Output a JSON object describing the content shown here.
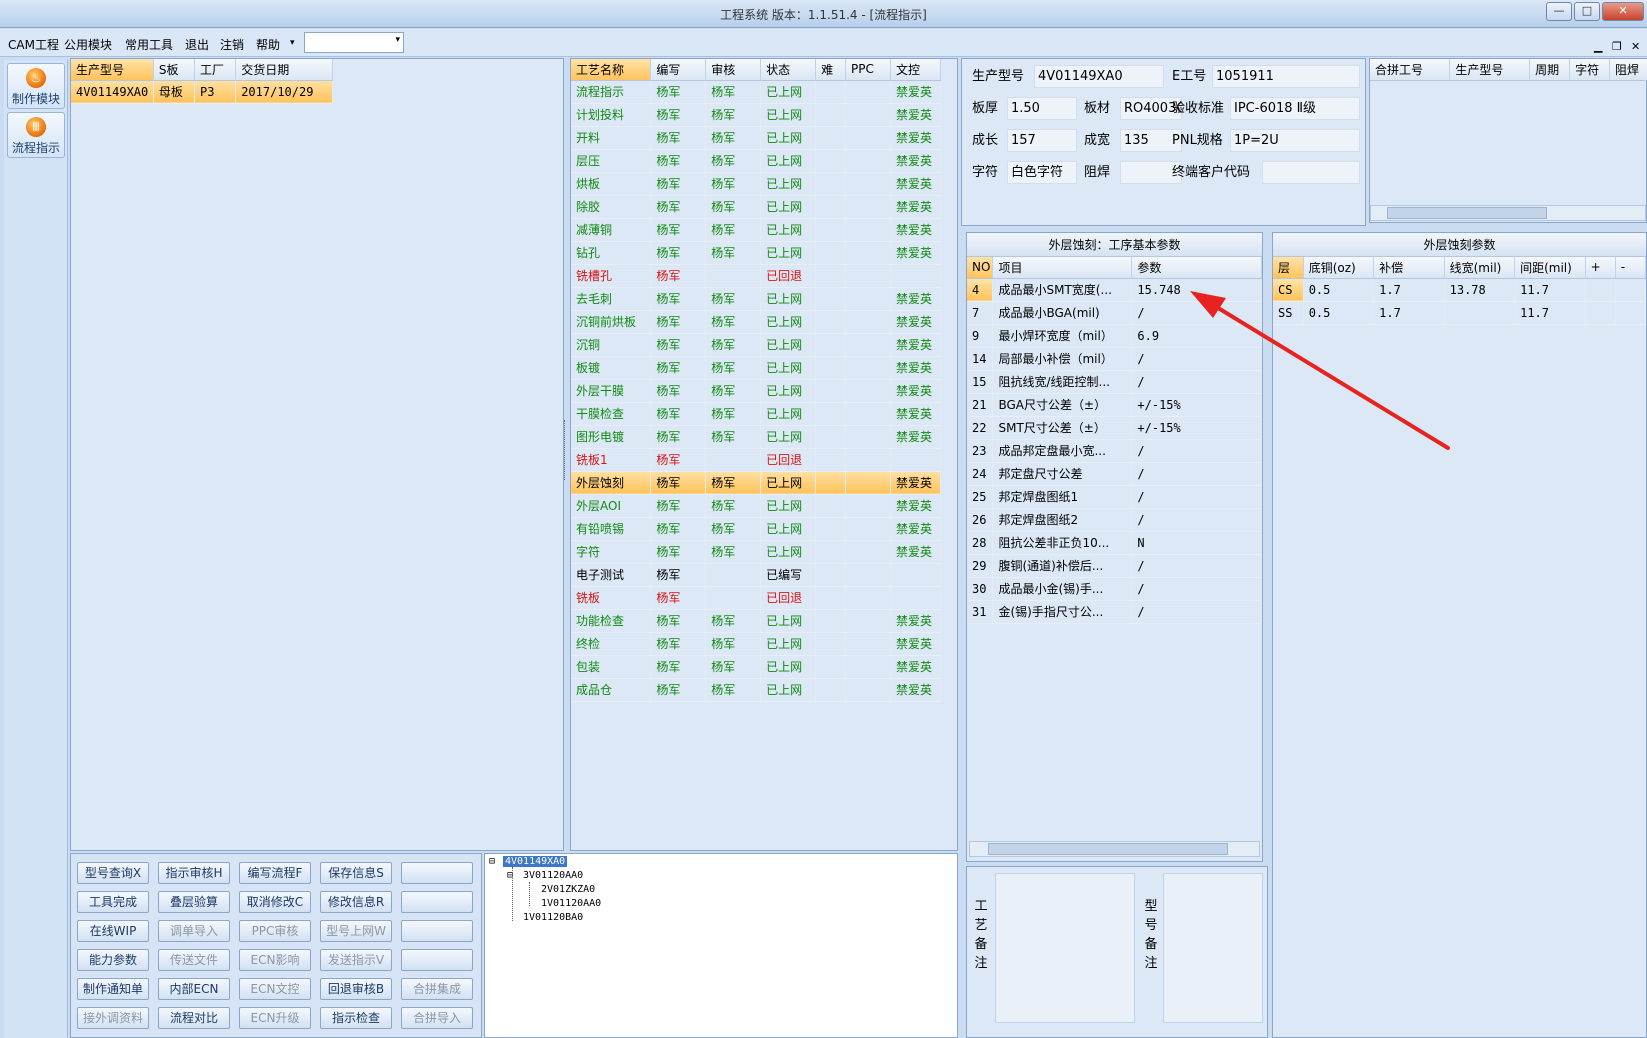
{
  "window": {
    "title": "工程系统   版本：1.1.51.4 - [流程指示]",
    "minimize": "—",
    "restore": "□",
    "close": "✕"
  },
  "menu": {
    "items": [
      "CAM工程",
      "公用模块",
      "常用工具",
      "退出",
      "注销",
      "帮助"
    ],
    "dropdown_arrow": "▾",
    "combo_value": "",
    "combo_arrow": "▾",
    "mdi_min": "▁",
    "mdi_restore": "❐",
    "mdi_close": "✕"
  },
  "left_nav": [
    {
      "label": "制作模块",
      "icon": "flame-icon",
      "glyph": "♨"
    },
    {
      "label": "流程指示",
      "icon": "flame-icon",
      "glyph": "Ⅲ"
    }
  ],
  "job_list": {
    "headers": [
      "生产型号",
      "S板",
      "工厂",
      "交货日期"
    ],
    "rows": [
      [
        "4V01149XA0",
        "母板",
        "P3",
        "2017/10/29"
      ]
    ]
  },
  "process": {
    "headers": [
      "工艺名称",
      "编写",
      "审核",
      "状态",
      "难",
      "PPC",
      "文控"
    ],
    "rows": [
      {
        "name": "流程指示",
        "writer": "杨军",
        "reviewer": "杨军",
        "status": "已上网",
        "control": "禁爱英",
        "color": "green"
      },
      {
        "name": "计划投料",
        "writer": "杨军",
        "reviewer": "杨军",
        "status": "已上网",
        "control": "禁爱英",
        "color": "green"
      },
      {
        "name": "开料",
        "writer": "杨军",
        "reviewer": "杨军",
        "status": "已上网",
        "control": "禁爱英",
        "color": "green"
      },
      {
        "name": "层压",
        "writer": "杨军",
        "reviewer": "杨军",
        "status": "已上网",
        "control": "禁爱英",
        "color": "green"
      },
      {
        "name": "烘板",
        "writer": "杨军",
        "reviewer": "杨军",
        "status": "已上网",
        "control": "禁爱英",
        "color": "green"
      },
      {
        "name": "除胶",
        "writer": "杨军",
        "reviewer": "杨军",
        "status": "已上网",
        "control": "禁爱英",
        "color": "green"
      },
      {
        "name": "减薄铜",
        "writer": "杨军",
        "reviewer": "杨军",
        "status": "已上网",
        "control": "禁爱英",
        "color": "green"
      },
      {
        "name": "钻孔",
        "writer": "杨军",
        "reviewer": "杨军",
        "status": "已上网",
        "control": "禁爱英",
        "color": "green"
      },
      {
        "name": "铣槽孔",
        "writer": "杨军",
        "reviewer": "",
        "status": "已回退",
        "control": "",
        "color": "red"
      },
      {
        "name": "去毛刺",
        "writer": "杨军",
        "reviewer": "杨军",
        "status": "已上网",
        "control": "禁爱英",
        "color": "green"
      },
      {
        "name": "沉铜前烘板",
        "writer": "杨军",
        "reviewer": "杨军",
        "status": "已上网",
        "control": "禁爱英",
        "color": "green"
      },
      {
        "name": "沉铜",
        "writer": "杨军",
        "reviewer": "杨军",
        "status": "已上网",
        "control": "禁爱英",
        "color": "green"
      },
      {
        "name": "板镀",
        "writer": "杨军",
        "reviewer": "杨军",
        "status": "已上网",
        "control": "禁爱英",
        "color": "green"
      },
      {
        "name": "外层干膜",
        "writer": "杨军",
        "reviewer": "杨军",
        "status": "已上网",
        "control": "禁爱英",
        "color": "green"
      },
      {
        "name": "干膜检查",
        "writer": "杨军",
        "reviewer": "杨军",
        "status": "已上网",
        "control": "禁爱英",
        "color": "green"
      },
      {
        "name": "图形电镀",
        "writer": "杨军",
        "reviewer": "杨军",
        "status": "已上网",
        "control": "禁爱英",
        "color": "green"
      },
      {
        "name": "铣板1",
        "writer": "杨军",
        "reviewer": "",
        "status": "已回退",
        "control": "",
        "color": "red"
      },
      {
        "name": "外层蚀刻",
        "writer": "杨军",
        "reviewer": "杨军",
        "status": "已上网",
        "control": "禁爱英",
        "color": "selected"
      },
      {
        "name": "外层AOI",
        "writer": "杨军",
        "reviewer": "杨军",
        "status": "已上网",
        "control": "禁爱英",
        "color": "green"
      },
      {
        "name": "有铅喷锡",
        "writer": "杨军",
        "reviewer": "杨军",
        "status": "已上网",
        "control": "禁爱英",
        "color": "green"
      },
      {
        "name": "字符",
        "writer": "杨军",
        "reviewer": "杨军",
        "status": "已上网",
        "control": "禁爱英",
        "color": "green"
      },
      {
        "name": "电子测试",
        "writer": "杨军",
        "reviewer": "",
        "status": "已编写",
        "control": "",
        "color": "black"
      },
      {
        "name": "铣板",
        "writer": "杨军",
        "reviewer": "",
        "status": "已回退",
        "control": "",
        "color": "red"
      },
      {
        "name": "功能检查",
        "writer": "杨军",
        "reviewer": "杨军",
        "status": "已上网",
        "control": "禁爱英",
        "color": "green"
      },
      {
        "name": "终检",
        "writer": "杨军",
        "reviewer": "杨军",
        "status": "已上网",
        "control": "禁爱英",
        "color": "green"
      },
      {
        "name": "包装",
        "writer": "杨军",
        "reviewer": "杨军",
        "status": "已上网",
        "control": "禁爱英",
        "color": "green"
      },
      {
        "name": "成品仓",
        "writer": "杨军",
        "reviewer": "杨军",
        "status": "已上网",
        "control": "禁爱英",
        "color": "green"
      }
    ]
  },
  "info": {
    "model_label": "生产型号",
    "model": "4V01149XA0",
    "e_label": "E工号",
    "e_no": "1051911",
    "thick_label": "板厚",
    "thick": "1.50",
    "material_label": "板材",
    "material": "RO4003C",
    "std_label": "验收标准",
    "std": "IPC-6018 Ⅱ级",
    "len_label": "成长",
    "len": "157",
    "wid_label": "成宽",
    "wid": "135",
    "pnl_label": "PNL规格",
    "pnl": "1P=2U",
    "char_label": "字符",
    "char": "白色字符",
    "mask_label": "阻焊",
    "mask": "",
    "cust_label": "终端客户代码",
    "cust": ""
  },
  "combine": {
    "headers": [
      "合拼工号",
      "生产型号",
      "周期",
      "字符",
      "阻焊"
    ]
  },
  "params": {
    "title": "外层蚀刻：工序基本参数",
    "headers": [
      "NO",
      "项目",
      "参数"
    ],
    "rows": [
      [
        "4",
        "成品最小SMT宽度(...",
        "15.748"
      ],
      [
        "7",
        "成品最小BGA(mil)",
        "/"
      ],
      [
        "9",
        "最小焊环宽度（mil）",
        "6.9"
      ],
      [
        "14",
        "局部最小补偿（mil）",
        "/"
      ],
      [
        "15",
        "阻抗线宽/线距控制...",
        "/"
      ],
      [
        "21",
        "BGA尺寸公差（±）",
        "+/-15%"
      ],
      [
        "22",
        "SMT尺寸公差（±）",
        "+/-15%"
      ],
      [
        "23",
        "成品邦定盘最小宽...",
        "/"
      ],
      [
        "24",
        "邦定盘尺寸公差",
        "/"
      ],
      [
        "25",
        "邦定焊盘图纸1",
        "/"
      ],
      [
        "26",
        "邦定焊盘图纸2",
        "/"
      ],
      [
        "28",
        "阻抗公差非正负10...",
        "N"
      ],
      [
        "29",
        "腹铜(通道)补偿后...",
        "/"
      ],
      [
        "30",
        "成品最小金(锡)手...",
        "/"
      ],
      [
        "31",
        "金(锡)手指尺寸公...",
        "/"
      ]
    ]
  },
  "etch": {
    "title": "外层蚀刻参数",
    "headers": [
      "层",
      "底铜(oz)",
      "补偿",
      "线宽(mil)",
      "间距(mil)",
      "+",
      "-"
    ],
    "rows": [
      [
        "CS",
        "0.5",
        "1.7",
        "13.78",
        "11.7",
        "",
        ""
      ],
      [
        "SS",
        "0.5",
        "1.7",
        "",
        "11.7",
        "",
        ""
      ]
    ]
  },
  "notes": {
    "process_label": [
      "工",
      "艺",
      "备",
      "注"
    ],
    "model_label": [
      "型",
      "号",
      "备",
      "注"
    ]
  },
  "buttons": [
    [
      {
        "t": "型号查询X",
        "e": 1
      },
      {
        "t": "指示审核H",
        "e": 1
      },
      {
        "t": "编写流程F",
        "e": 1
      },
      {
        "t": "保存信息S",
        "e": 1
      },
      {
        "t": "",
        "e": 1
      }
    ],
    [
      {
        "t": "工具完成",
        "e": 1
      },
      {
        "t": "叠层验算",
        "e": 1
      },
      {
        "t": "取消修改C",
        "e": 1
      },
      {
        "t": "修改信息R",
        "e": 1
      },
      {
        "t": "",
        "e": 1
      }
    ],
    [
      {
        "t": "在线WIP",
        "e": 1
      },
      {
        "t": "调单导入",
        "e": 0
      },
      {
        "t": "PPC审核",
        "e": 0
      },
      {
        "t": "型号上网W",
        "e": 0
      },
      {
        "t": "",
        "e": 1
      }
    ],
    [
      {
        "t": "能力参数",
        "e": 1
      },
      {
        "t": "传送文件",
        "e": 0
      },
      {
        "t": "ECN影响",
        "e": 0
      },
      {
        "t": "发送指示V",
        "e": 0
      },
      {
        "t": "",
        "e": 1
      }
    ],
    [
      {
        "t": "制作通知单",
        "e": 1
      },
      {
        "t": "内部ECN",
        "e": 1
      },
      {
        "t": "ECN文控",
        "e": 0
      },
      {
        "t": "回退审核B",
        "e": 1
      },
      {
        "t": "合拼集成",
        "e": 0
      }
    ],
    [
      {
        "t": "接外调资料",
        "e": 0
      },
      {
        "t": "流程对比",
        "e": 1
      },
      {
        "t": "ECN升级",
        "e": 0
      },
      {
        "t": "指示检查",
        "e": 1
      },
      {
        "t": "合拼导入",
        "e": 0
      }
    ]
  ],
  "tree": {
    "root": "4V01149XA0",
    "n1": "3V01120AA0",
    "n2": "2V01ZKZA0",
    "n3": "1V01120AA0",
    "n4": "1V01120BA0",
    "expander": "⊟"
  },
  "annotation": {
    "color": "#e8231f"
  }
}
